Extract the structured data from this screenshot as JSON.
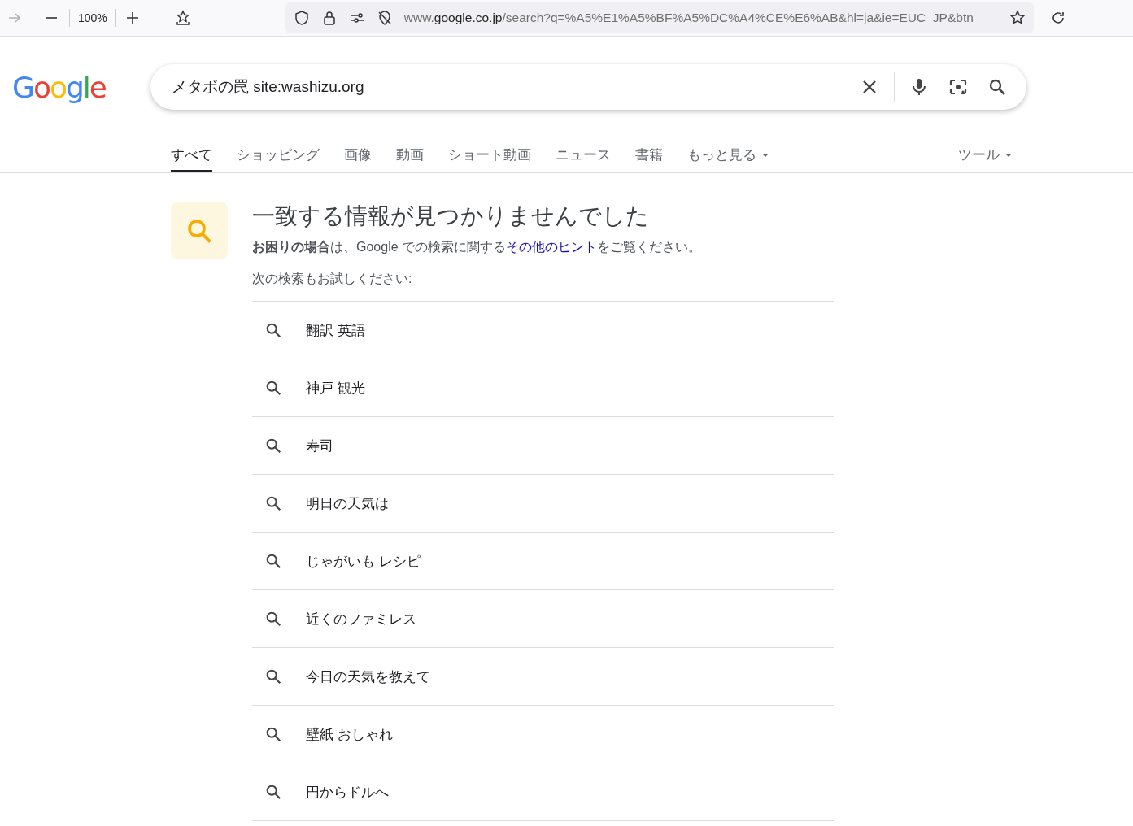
{
  "browser": {
    "zoom": "100%",
    "url": {
      "prefix": "www.",
      "domain": "google.co.jp",
      "path": "/search?q=%A5%E1%A5%BF%A5%DC%A4%CE%E6%AB&hl=ja&ie=EUC_JP&btn"
    }
  },
  "logo": "Google",
  "search": {
    "value": "メタボの罠 site:washizu.org"
  },
  "tabs": [
    {
      "label": "すべて",
      "selected": true,
      "dropdown": false
    },
    {
      "label": "ショッピング",
      "selected": false,
      "dropdown": false
    },
    {
      "label": "画像",
      "selected": false,
      "dropdown": false
    },
    {
      "label": "動画",
      "selected": false,
      "dropdown": false
    },
    {
      "label": "ショート動画",
      "selected": false,
      "dropdown": false
    },
    {
      "label": "ニュース",
      "selected": false,
      "dropdown": false
    },
    {
      "label": "書籍",
      "selected": false,
      "dropdown": false
    },
    {
      "label": "もっと見る",
      "selected": false,
      "dropdown": true
    }
  ],
  "tools": {
    "label": "ツール",
    "dropdown": true
  },
  "result": {
    "title": "一致する情報が見つかりませんでした",
    "hint_before": "**お困りの場合**は、Google での検索に関する",
    "hint_link": "その他のヒント",
    "hint_after": "をご覧ください。",
    "try_label": "次の検索もお試しください:"
  },
  "suggestions": [
    "翻訳 英語",
    "神戸 観光",
    "寿司",
    "明日の天気は",
    "じゃがいも レシピ",
    "近くのファミレス",
    "今日の天気を教えて",
    "壁紙 おしゃれ",
    "円からドルへ"
  ]
}
